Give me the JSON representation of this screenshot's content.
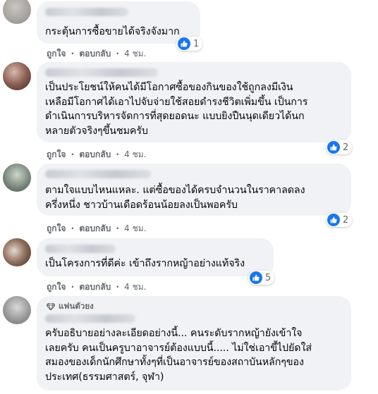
{
  "meta_labels": {
    "like": "ถูกใจ",
    "reply": "ตอบกลับ",
    "separator": "·"
  },
  "comments": [
    {
      "text": "กระตุ้นการซื้อขายได้จริงจังมาก",
      "time": "4 ชม.",
      "reactions": "1"
    },
    {
      "text": "เป็นประโยชน์ให้คนได้มีโอกาศซื้อของกินของใช้ถูกลงมีเงิน\nเหลือมีโอกาศได้เอาไปจับจ่ายใช้สอยดำรงชีวิตเพิ่มขึ้น เป็นการ\nดำเนินการบริหารจัดการที่สุดยอดนะ แบบยิงปืนนุดเดียวได้นก\nหลายตัวจริงๆขึ้นชมครับ",
      "time": "4 ชม.",
      "reactions": "2"
    },
    {
      "text": "ตามใจแบบไหนแหละ. แต่ซื้อของได้ครบจำนวนในราคาลดลง\nครึ่งหนึ่ง ชาวบ้านเดือดร้อนน้อยลงเป็นพอครับ",
      "time": "4 ชม.",
      "reactions": "2"
    },
    {
      "text": "เป็นโครงการที่ดีค่ะ เข้าถึงรากหญ้าอย่างแท้จริง",
      "time": "4 ชม.",
      "reactions": "5"
    },
    {
      "badge": "แฟนตัวยง",
      "text": "ครับอธิบายอย่างละเอียดอย่างนี้... คนระดับรากหญ้ายังเข้าใจ\nเลยครับ คนเป็นครูบาอาจารย์ต้องแบบนี้..... ไม่ใช่เอาขี้ไปยัดใส่\nสมองของเด็กนักศึกษาทั้งๆที่เป็นอาจารย์ของสถาบันหลักๆของ\nประเทศ(ธรรมศาสตร์, จุฬา)"
    }
  ],
  "icons": {
    "like_reaction": "thumbs-up-icon",
    "fan_badge": "diamond-icon"
  },
  "colors": {
    "bubble": "#f0f2f5",
    "meta_text": "#65676b",
    "like_blue": "#1877f2"
  }
}
